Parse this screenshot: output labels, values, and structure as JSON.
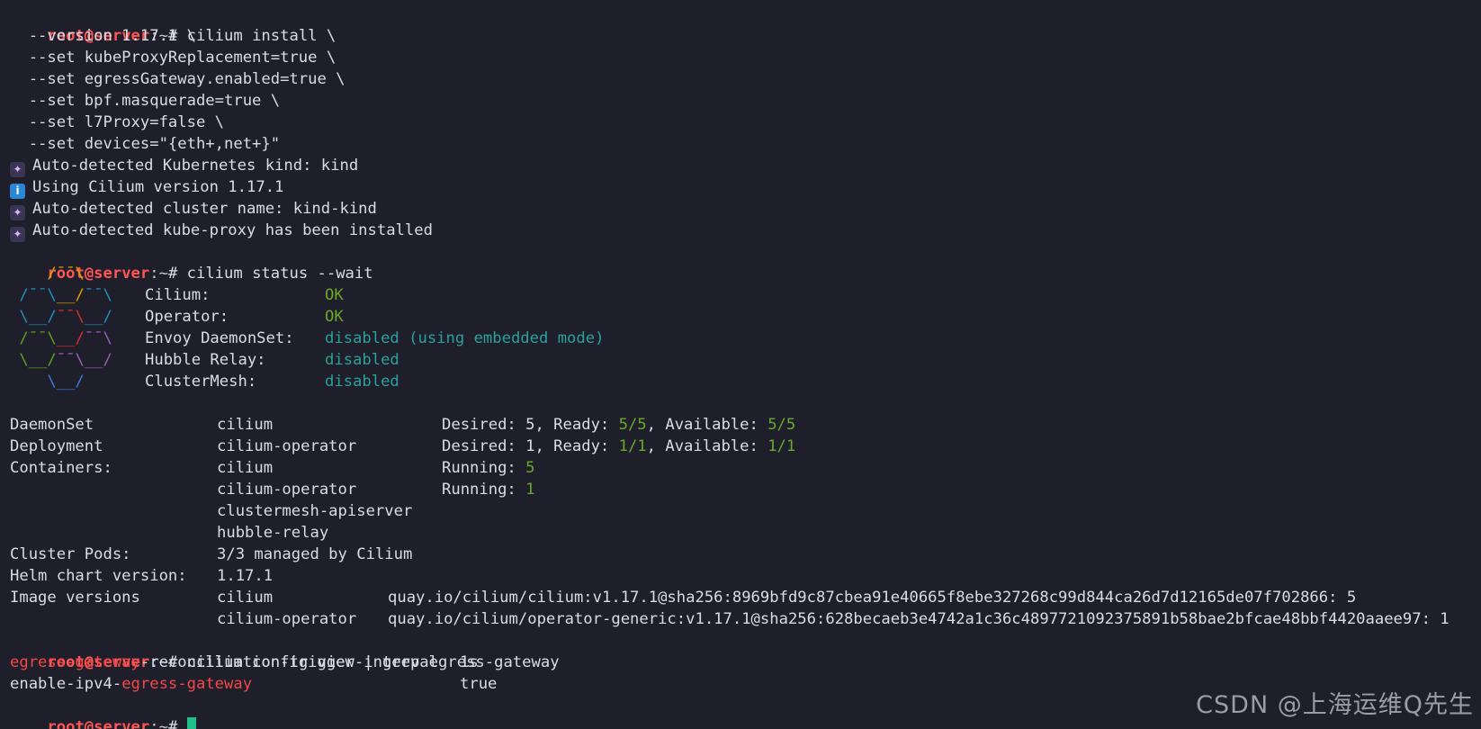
{
  "prompt": {
    "user": "root@server",
    "path": ":~",
    "sym": "# "
  },
  "commands": {
    "install": "cilium install \\",
    "install_args": [
      "  --version 1.17.1 \\",
      "  --set kubeProxyReplacement=true \\",
      "  --set egressGateway.enabled=true \\",
      "  --set bpf.masquerade=true \\",
      "  --set l7Proxy=false \\",
      "  --set devices=\"{eth+,net+}\""
    ],
    "status": "cilium status --wait",
    "config": "cilium config view | grep egress-gateway"
  },
  "install_output": [
    {
      "icon": "wizard-icon",
      "text": "Auto-detected Kubernetes kind: kind"
    },
    {
      "icon": "info-icon",
      "text": "Using Cilium version 1.17.1"
    },
    {
      "icon": "wizard-icon",
      "text": "Auto-detected cluster name: kind-kind"
    },
    {
      "icon": "wizard-icon",
      "text": "Auto-detected kube-proxy has been installed"
    }
  ],
  "logo": [
    "    /¯¯\\",
    " /¯¯\\__/¯¯\\",
    " \\__/¯¯\\__/",
    " /¯¯\\__/¯¯\\",
    " \\__/¯¯\\__/",
    "    \\__/"
  ],
  "status_items": [
    {
      "label": "Cilium:",
      "value": "OK",
      "kind": "ok"
    },
    {
      "label": "Operator:",
      "value": "OK",
      "kind": "ok"
    },
    {
      "label": "Envoy DaemonSet:",
      "value": "disabled (using embedded mode)",
      "kind": "dis"
    },
    {
      "label": "Hubble Relay:",
      "value": "disabled",
      "kind": "dis"
    },
    {
      "label": "ClusterMesh:",
      "value": "disabled",
      "kind": "dis"
    }
  ],
  "resources": {
    "daemonset": {
      "label": "DaemonSet",
      "name": "cilium",
      "desired_label": "Desired: 5, Ready: ",
      "ready": "5/5",
      "avail_label": ", Available: ",
      "available": "5/5"
    },
    "deployment": {
      "label": "Deployment",
      "name": "cilium-operator",
      "desired_label": "Desired: 1, Ready: ",
      "ready": "1/1",
      "avail_label": ", Available: ",
      "available": "1/1"
    },
    "containers_label": "Containers:",
    "containers": [
      {
        "name": "cilium",
        "running_label": "Running: ",
        "running": "5"
      },
      {
        "name": "cilium-operator",
        "running_label": "Running: ",
        "running": "1"
      },
      {
        "name": "clustermesh-apiserver"
      },
      {
        "name": "hubble-relay"
      }
    ],
    "cluster_pods_label": "Cluster Pods:",
    "cluster_pods": "3/3 managed by Cilium",
    "helm_label": "Helm chart version:",
    "helm_version": "1.17.1",
    "images_label": "Image versions",
    "images": [
      {
        "name": "cilium",
        "ref": "quay.io/cilium/cilium:v1.17.1@sha256:8969bfd9c87cbea91e40665f8ebe327268c99d844ca26d7d12165de07f702866: 5"
      },
      {
        "name": "cilium-operator",
        "ref": "quay.io/cilium/operator-generic:v1.17.1@sha256:628becaeb3e4742a1c36c4897721092375891b58bae2bfcae48bbf4420aaee97: 1"
      }
    ]
  },
  "config_output": [
    {
      "pre": "",
      "match": "egress-gateway",
      "post": "-reconciliation-trigger-interval",
      "value": "1s"
    },
    {
      "pre": "enable-ipv4-",
      "match": "egress-gateway",
      "post": "",
      "value": "true"
    }
  ],
  "watermark": "CSDN @上海运维Q先生",
  "colors": {
    "background": "#1e1f2b",
    "prompt_user": "#ff5555",
    "ok": "#6aa82a",
    "disabled": "#2aa198",
    "grep_match": "#f44747",
    "cursor": "#1fc08a"
  }
}
